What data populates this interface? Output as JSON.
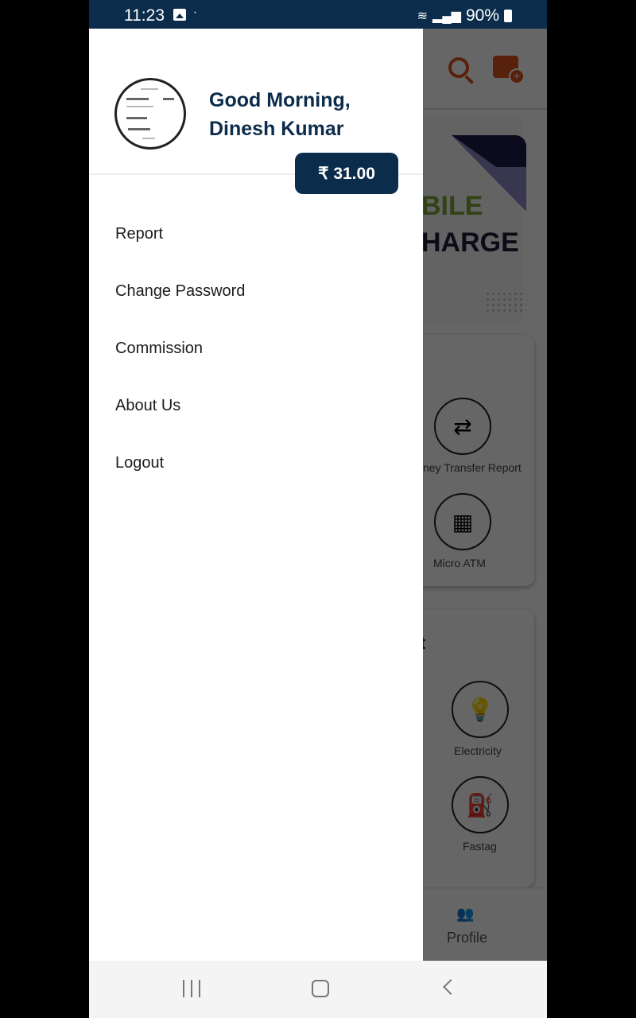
{
  "status_bar": {
    "time": "11:23",
    "battery": "90%",
    "icons": [
      "gallery-icon",
      "app-notification-icon",
      "wifi-icon",
      "signal-icon",
      "battery-icon"
    ]
  },
  "background_app": {
    "header_icons": [
      "search-icon",
      "add-wallet-icon"
    ],
    "banner": {
      "line1": "BILE",
      "line2": "HARGE"
    },
    "services": [
      {
        "label": "ney Transfer Report",
        "icon": "money-transfer-icon"
      },
      {
        "label": "Micro ATM",
        "icon": "atm-icon"
      }
    ],
    "section_heading": "t",
    "bill_services": [
      {
        "label": "Electricity",
        "icon": "bulb-icon"
      },
      {
        "label": "Fastag",
        "icon": "fastag-icon"
      }
    ],
    "bottom_nav": {
      "label": "Profile",
      "icon": "profile-group-icon"
    }
  },
  "drawer": {
    "greeting": "Good Morning,",
    "user_name": "Dinesh Kumar",
    "balance": "₹ 31.00",
    "menu": [
      {
        "label": "Report"
      },
      {
        "label": "Change Password"
      },
      {
        "label": "Commission"
      },
      {
        "label": "About Us"
      },
      {
        "label": "Logout"
      }
    ]
  },
  "system_nav": [
    "recent-apps-icon",
    "home-icon",
    "back-icon"
  ],
  "colors": {
    "primary": "#0b2c4a",
    "accent": "#d9531e"
  }
}
